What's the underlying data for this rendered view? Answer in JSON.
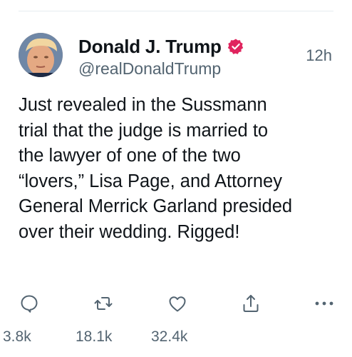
{
  "author": {
    "display_name": "Donald J. Trump",
    "handle": "@realDonaldTrump",
    "verified": true
  },
  "timestamp": "12h",
  "tweet": {
    "text": "Just revealed in the Sussmann\ntrial that the judge is married to\nthe lawyer of one of the two\n“lovers,” Lisa Page, and Attorney\nGeneral Merrick Garland presided\nover their wedding. Rigged!"
  },
  "actions": [
    {
      "name": "reply",
      "icon": "reply-icon",
      "count": "3.8k"
    },
    {
      "name": "retweet",
      "icon": "retweet-icon",
      "count": "18.1k"
    },
    {
      "name": "like",
      "icon": "heart-icon",
      "count": "32.4k"
    },
    {
      "name": "share",
      "icon": "share-icon",
      "count": ""
    },
    {
      "name": "more",
      "icon": "more-icon",
      "count": ""
    }
  ],
  "colors": {
    "verified_badge": "#e0245e",
    "secondary_text": "#536471",
    "icon": "#536471"
  }
}
